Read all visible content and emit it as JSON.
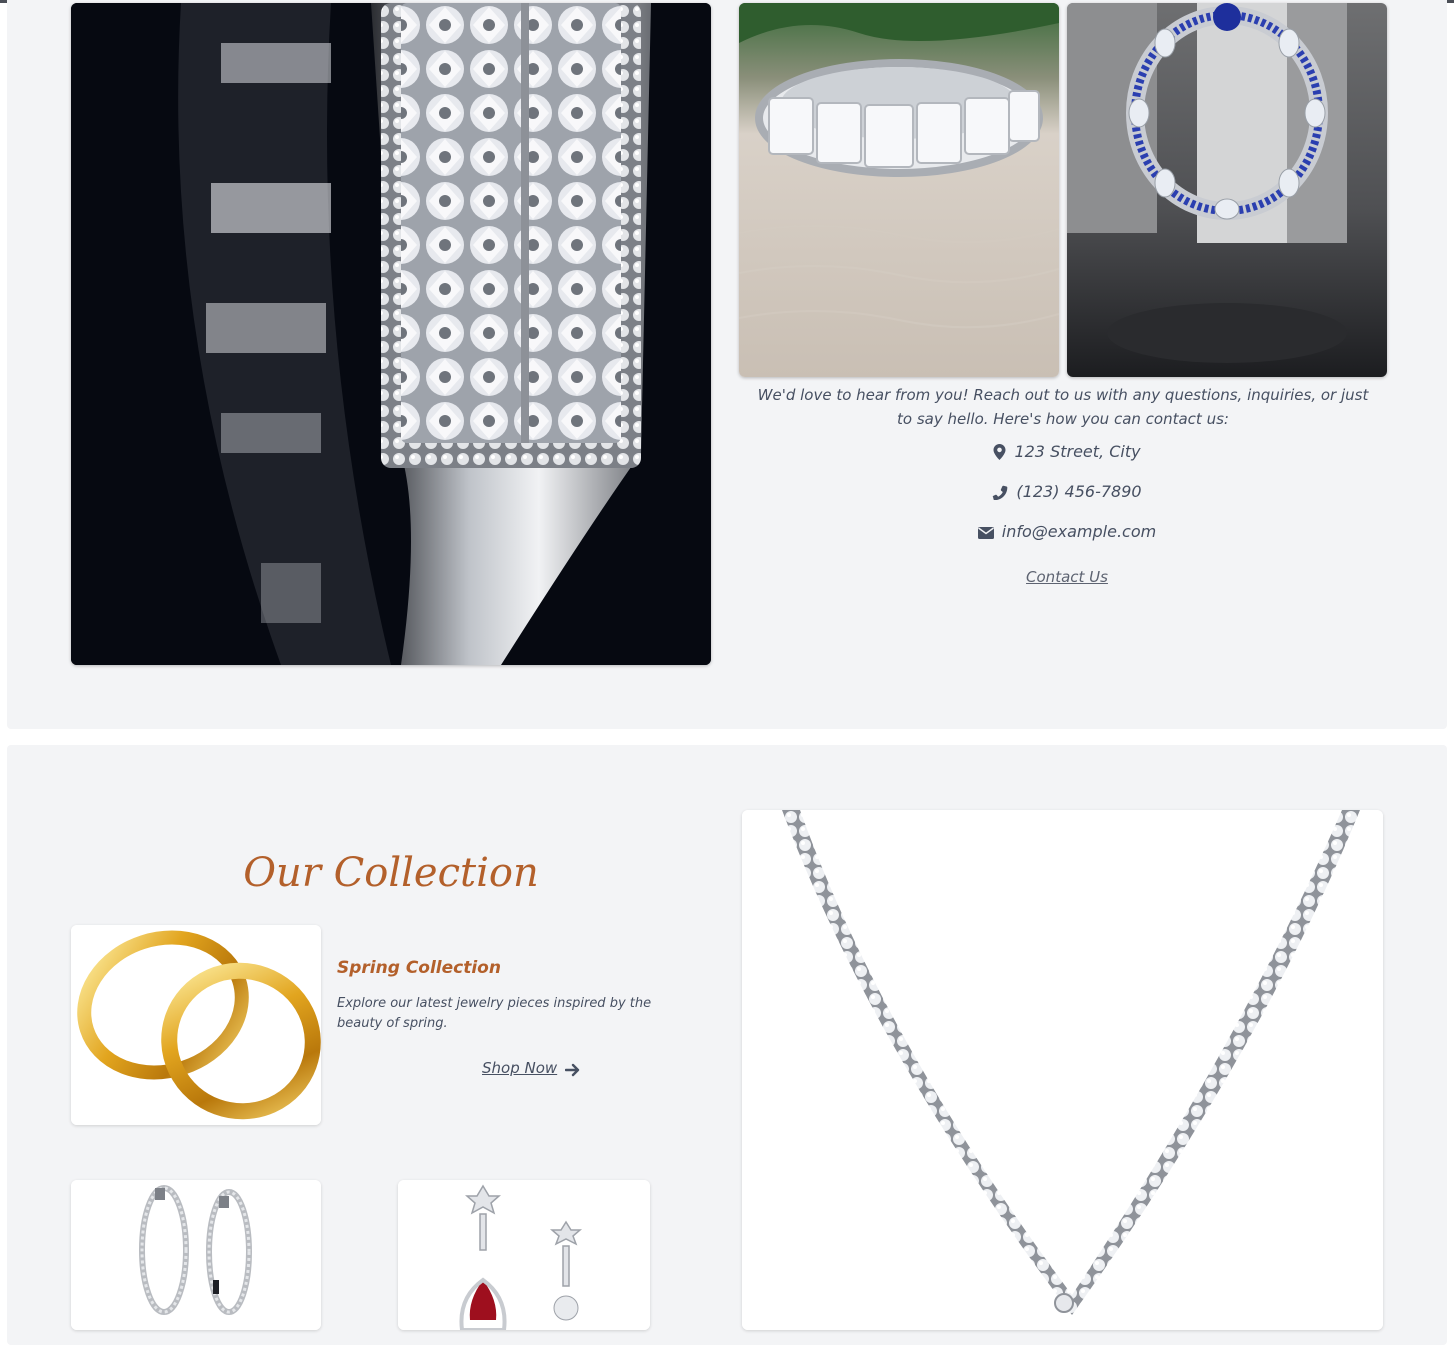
{
  "contact": {
    "intro": "We'd love to hear from you! Reach out to us with any questions, inquiries, or just to say hello. Here's how you can contact us:",
    "address": "123 Street, City",
    "phone": "(123) 456-7890",
    "email": "info@example.com",
    "link_label": "Contact Us",
    "icons": [
      "map-pin-icon",
      "phone-icon",
      "envelope-icon"
    ]
  },
  "collection": {
    "title": "Our Collection",
    "featured": {
      "title": "Spring Collection",
      "description": "Explore our latest jewelry pieces inspired by the beauty of spring.",
      "cta_label": "Shop Now",
      "cta_icon": "arrow-right-icon"
    }
  },
  "colors": {
    "section_bg": "#f3f4f6",
    "accent": "#b3602b",
    "text": "#475062"
  }
}
